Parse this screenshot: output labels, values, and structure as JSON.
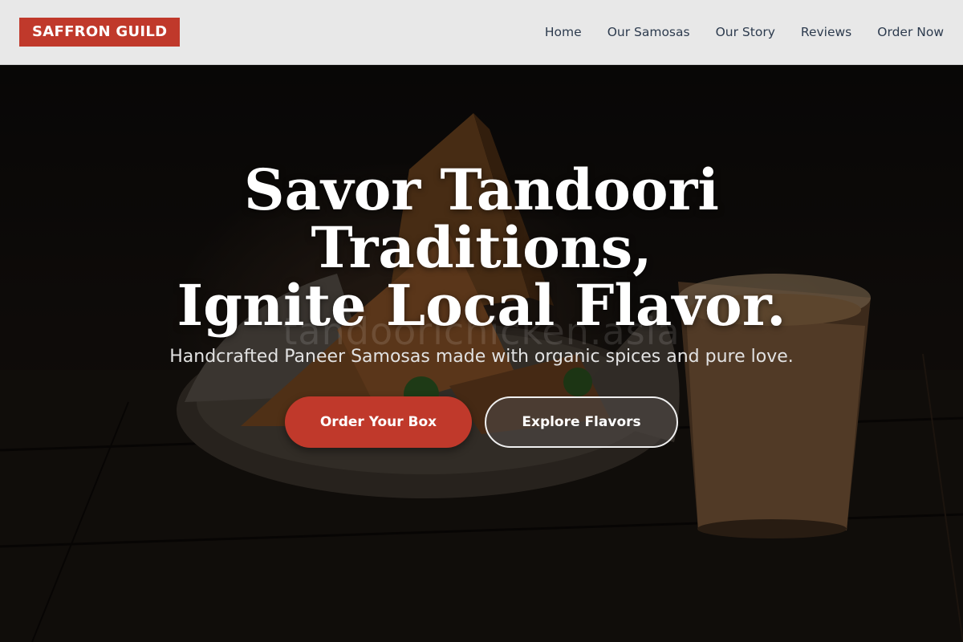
{
  "brand": {
    "name": "SAFFRON GUILD",
    "color": "#c0392b"
  },
  "nav": {
    "links": [
      {
        "label": "Home"
      },
      {
        "label": "Our Samosas"
      },
      {
        "label": "Our Story"
      },
      {
        "label": "Reviews"
      },
      {
        "label": "Order Now"
      }
    ]
  },
  "hero": {
    "title_line1": "Savor Tandoori",
    "title_line2": "Traditions,",
    "title_line3": "Ignite Local Flavor.",
    "subtitle": "Handcrafted Paneer Samosas made with organic spices and pure love.",
    "watermark": "tandoorichicken.asia",
    "background_image": "samosas-with-masala-chai-on-dark-wood",
    "primary_button": "Order Your Box",
    "secondary_button": "Explore Flavors"
  }
}
